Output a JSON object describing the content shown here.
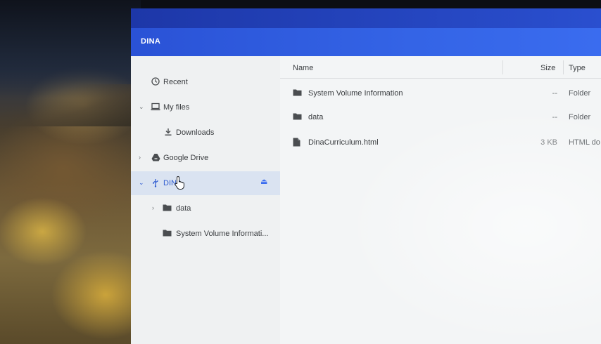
{
  "window": {
    "title": "DINA"
  },
  "sidebar": {
    "items": [
      {
        "label": "Recent",
        "icon": "clock-icon",
        "expander": ""
      },
      {
        "label": "My files",
        "icon": "laptop-icon",
        "expander": "⌄"
      },
      {
        "label": "Downloads",
        "icon": "download-icon",
        "expander": ""
      },
      {
        "label": "Google Drive",
        "icon": "drive-icon",
        "expander": "›"
      },
      {
        "label": "DINA",
        "icon": "usb-icon",
        "expander": "⌄"
      },
      {
        "label": "data",
        "icon": "folder-icon",
        "expander": "›"
      },
      {
        "label": "System Volume Informati...",
        "icon": "folder-icon",
        "expander": ""
      }
    ]
  },
  "filelist": {
    "columns": {
      "name": "Name",
      "size": "Size",
      "type": "Type"
    },
    "rows": [
      {
        "name": "System Volume Information",
        "size": "--",
        "type": "Folder",
        "icon": "folder-icon"
      },
      {
        "name": "data",
        "size": "--",
        "type": "Folder",
        "icon": "folder-icon"
      },
      {
        "name": "DinaCurriculum.html",
        "size": "3 KB",
        "type": "HTML do",
        "icon": "file-icon"
      }
    ]
  },
  "colors": {
    "accent": "#3a6cef",
    "titlebar": "#2a52d6"
  }
}
